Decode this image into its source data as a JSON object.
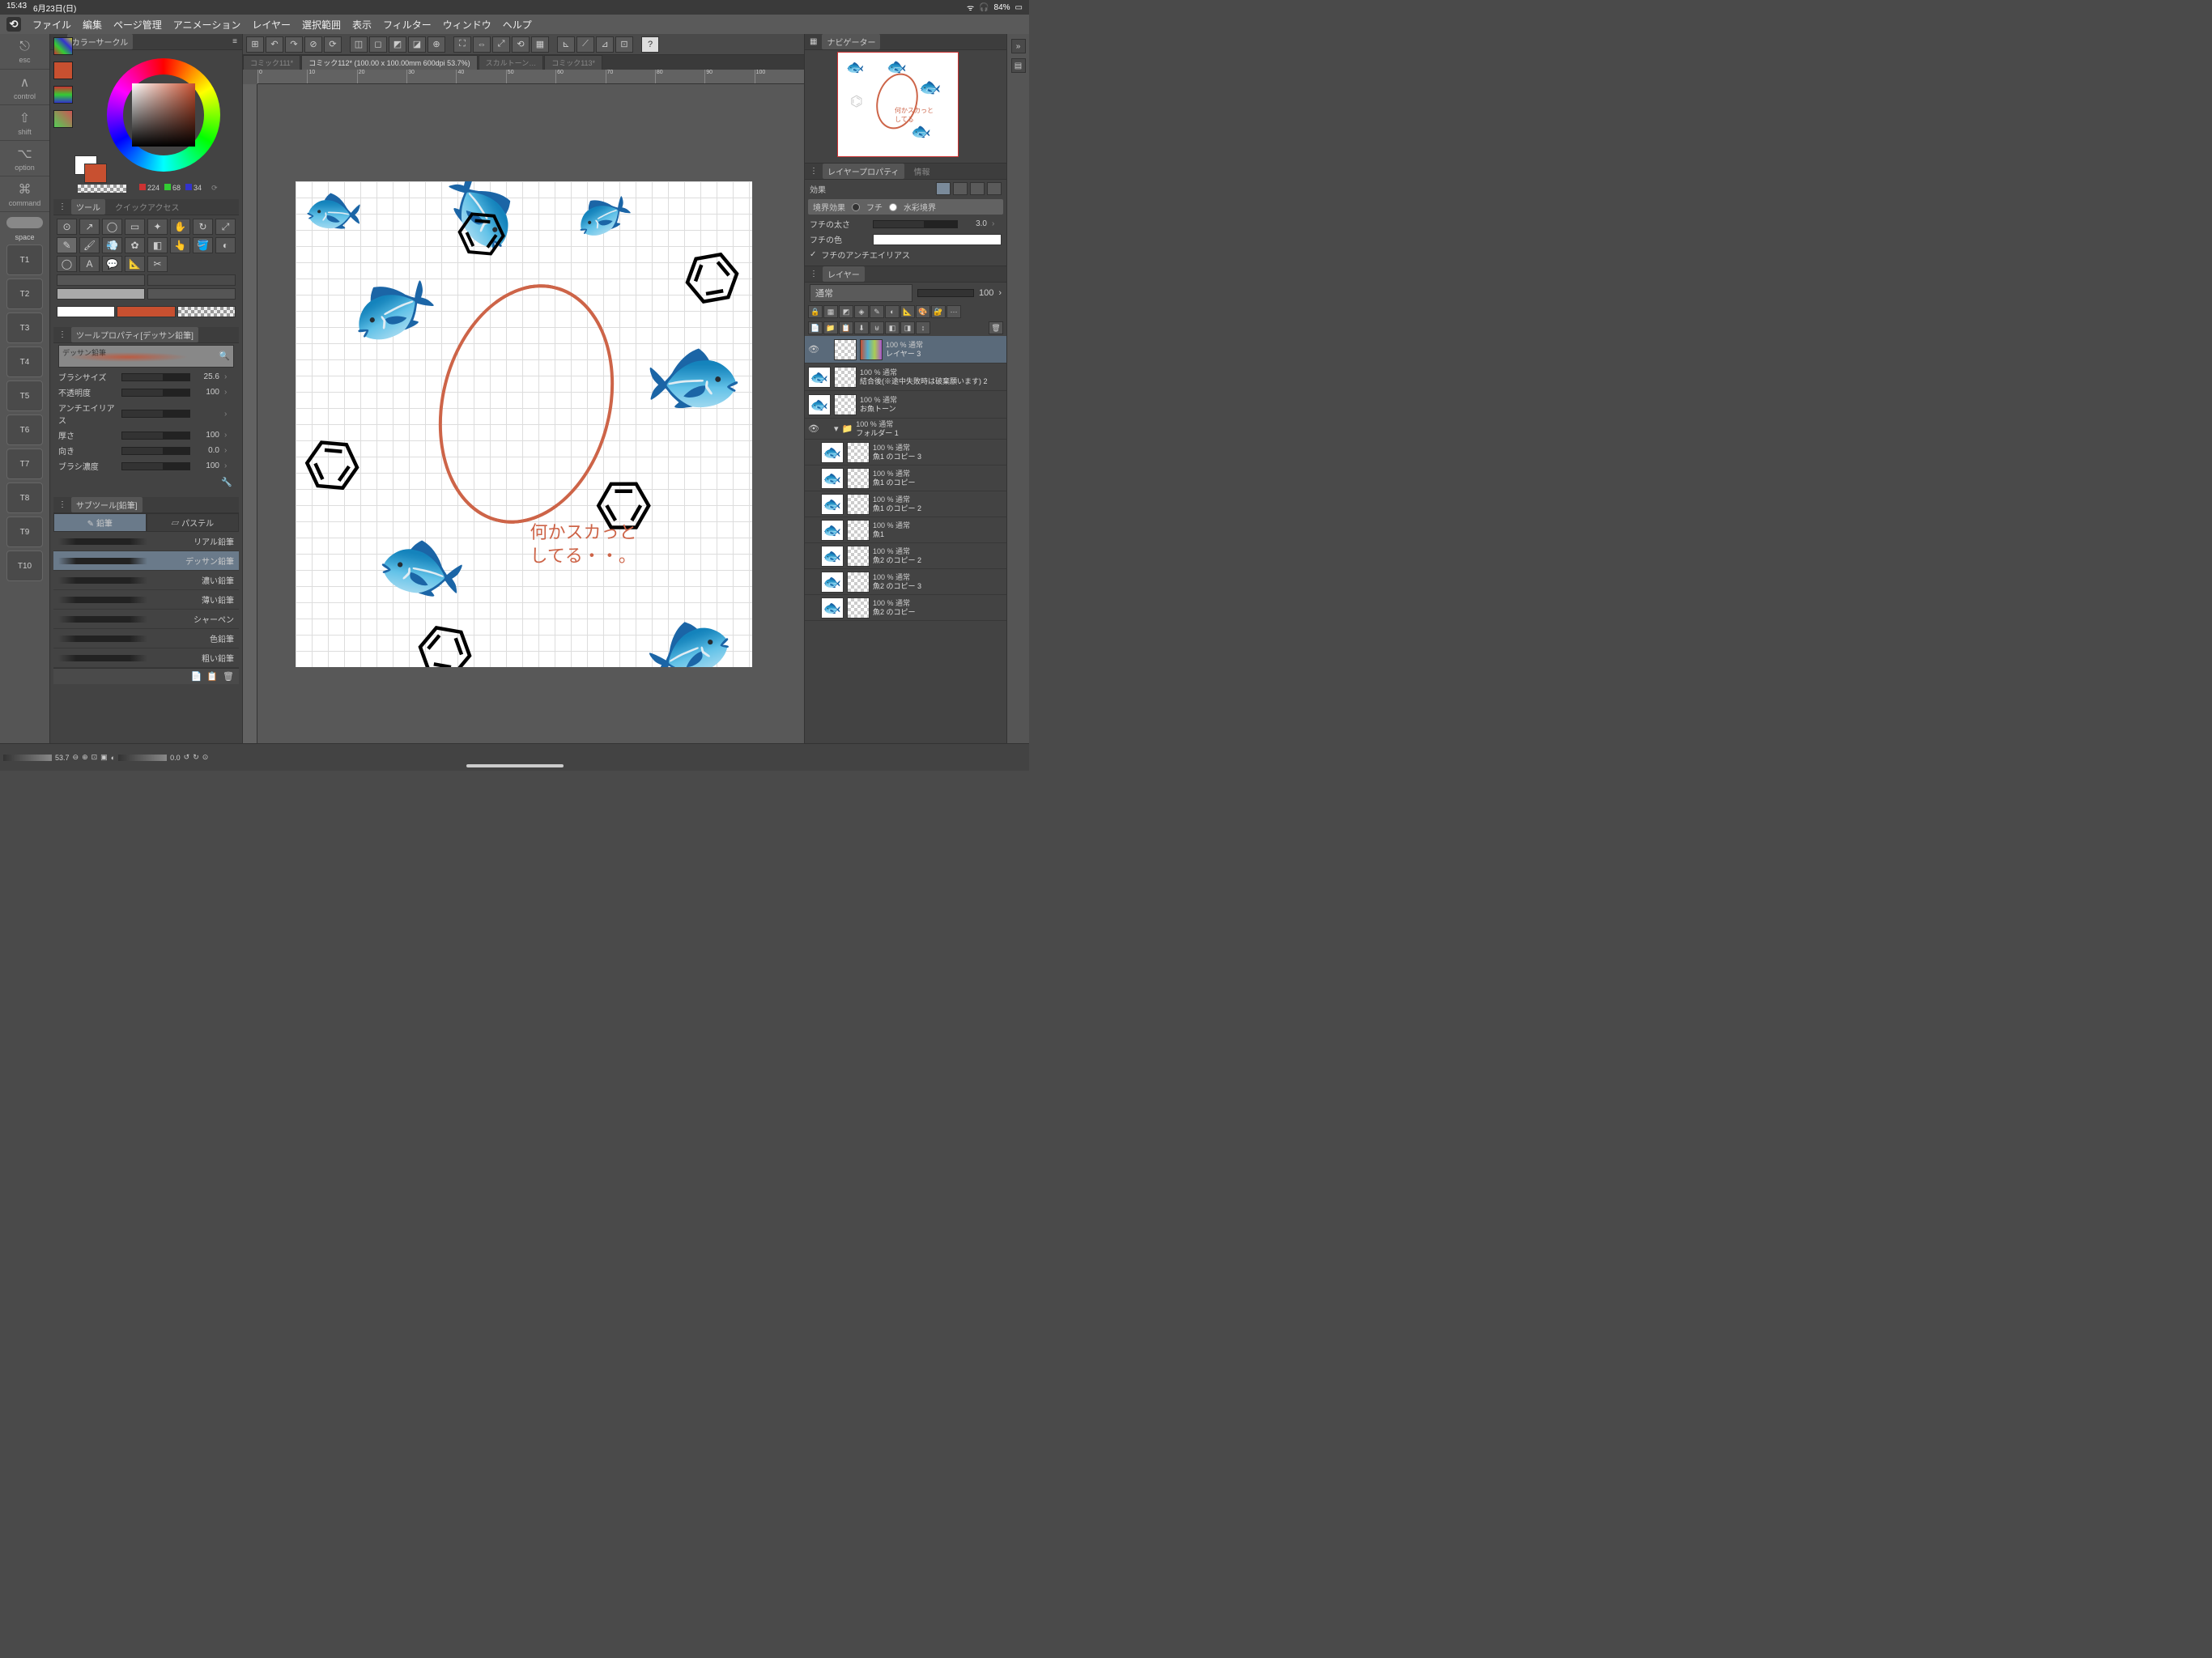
{
  "status": {
    "time": "15:43",
    "date": "6月23日(日)",
    "battery": "84%"
  },
  "menu": [
    "ファイル",
    "編集",
    "ページ管理",
    "アニメーション",
    "レイヤー",
    "選択範囲",
    "表示",
    "フィルター",
    "ウィンドウ",
    "ヘルプ"
  ],
  "rail": {
    "esc": "esc",
    "control": "control",
    "shift": "shift",
    "option": "option",
    "command": "command",
    "space": "space"
  },
  "rail_nums": [
    "T1",
    "T2",
    "T3",
    "T4",
    "T5",
    "T6",
    "T7",
    "T8",
    "T9",
    "T10"
  ],
  "color_panel": {
    "title": "カラーサークル",
    "r": "224",
    "g": "68",
    "b": "34"
  },
  "tool_panel": {
    "title": "ツール",
    "quick": "クイックアクセス"
  },
  "tool_prop": {
    "title": "ツールプロパティ[デッサン鉛筆]",
    "preset": "デッサン鉛筆",
    "rows": [
      {
        "label": "ブラシサイズ",
        "value": "25.6"
      },
      {
        "label": "不透明度",
        "value": "100"
      },
      {
        "label": "アンチエイリアス",
        "value": ""
      },
      {
        "label": "厚さ",
        "value": "100"
      },
      {
        "label": "向き",
        "value": "0.0"
      },
      {
        "label": "ブラシ濃度",
        "value": "100"
      }
    ]
  },
  "subtool": {
    "title": "サブツール[鉛筆]",
    "tabs": [
      "鉛筆",
      "パステル"
    ],
    "items": [
      "リアル鉛筆",
      "デッサン鉛筆",
      "濃い鉛筆",
      "薄い鉛筆",
      "シャーペン",
      "色鉛筆",
      "粗い鉛筆"
    ],
    "active_index": 1
  },
  "doc_tabs": [
    {
      "label": "コミック111*",
      "active": false
    },
    {
      "label": "コミック112* (100.00 x 100.00mm 600dpi 53.7%)",
      "active": true
    },
    {
      "label": "スカルトーン…",
      "active": false
    },
    {
      "label": "コミック113*",
      "active": false
    }
  ],
  "canvas_annotation": {
    "line1": "何かスカっと",
    "line2": "してる・・。"
  },
  "navigator": {
    "title": "ナビゲーター",
    "zoom": "53.7",
    "angle": "0.0"
  },
  "layer_prop": {
    "title": "レイヤープロパティ",
    "info": "情報",
    "effect": "効果",
    "border_label": "境界効果",
    "fuchi": "フチ",
    "suisai": "水彩境界",
    "thickness_label": "フチの太さ",
    "thickness": "3.0",
    "color_label": "フチの色",
    "aa": "フチのアンチエイリアス"
  },
  "layers": {
    "title": "レイヤー",
    "blend": "通常",
    "opacity": "100",
    "items": [
      {
        "op": "100 % 通常",
        "name": "レイヤー 3",
        "selected": true,
        "thumb": "pal"
      },
      {
        "op": "100 % 通常",
        "name": "結合後(※途中失敗時は破棄願います) 2",
        "thumb": "fish"
      },
      {
        "op": "100 % 通常",
        "name": "お魚トーン",
        "thumb": "fish"
      },
      {
        "op": "100 % 通常",
        "name": "フォルダー 1",
        "folder": true
      },
      {
        "op": "100 % 通常",
        "name": "魚1 のコピー 3",
        "sub": true,
        "thumb": "fish"
      },
      {
        "op": "100 % 通常",
        "name": "魚1 のコピー",
        "sub": true,
        "thumb": "fish"
      },
      {
        "op": "100 % 通常",
        "name": "魚1 のコピー 2",
        "sub": true,
        "thumb": "fish"
      },
      {
        "op": "100 % 通常",
        "name": "魚1",
        "sub": true,
        "thumb": "fish"
      },
      {
        "op": "100 % 通常",
        "name": "魚2 のコピー 2",
        "sub": true,
        "thumb": "fish"
      },
      {
        "op": "100 % 通常",
        "name": "魚2 のコピー 3",
        "sub": true,
        "thumb": "fish"
      },
      {
        "op": "100 % 通常",
        "name": "魚2 のコピー",
        "sub": true,
        "thumb": "fish"
      }
    ]
  },
  "ruler_marks": [
    "0",
    "10",
    "20",
    "30",
    "40",
    "50",
    "60",
    "70",
    "80",
    "90",
    "100"
  ]
}
